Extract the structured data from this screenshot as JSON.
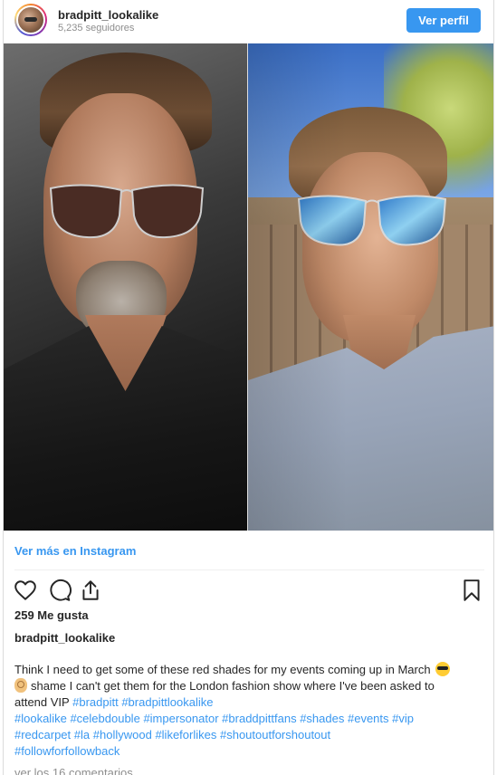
{
  "header": {
    "username": "bradpitt_lookalike",
    "followers": "5,235 seguidores",
    "view_profile_label": "Ver perfil"
  },
  "media": {
    "description_left": "celebrity-photo",
    "description_right": "lookalike-selfie"
  },
  "links": {
    "see_more": "Ver más en Instagram"
  },
  "actions": {
    "like_icon": "heart-icon",
    "comment_icon": "comment-icon",
    "share_icon": "share-icon",
    "save_icon": "bookmark-icon"
  },
  "likes": "259 Me gusta",
  "caption": {
    "username": "bradpitt_lookalike",
    "line1": "Think I need to get some of these red shades for my events coming up in March",
    "line2": "shame I can't get them for the London fashion show where I've been asked to",
    "line3_text": "attend VIP",
    "line3_tags": [
      "#bradpitt",
      "#bradpittlookalike"
    ],
    "line4_tags": [
      "#lookalike",
      "#celebdouble",
      "#impersonator",
      "#braddpittfans",
      "#shades",
      "#events",
      "#vip"
    ],
    "line5_tags": [
      "#redcarpet",
      "#la",
      "#hollywood",
      "#likeforlikes",
      "#shoutoutforshoutout"
    ],
    "line6_tags": [
      "#followforfollowback"
    ]
  },
  "comments_link": "ver los 16 comentarios",
  "colors": {
    "accent": "#3897f0",
    "text": "#262626",
    "muted": "#8e8e8e",
    "border": "#dbdbdb"
  }
}
